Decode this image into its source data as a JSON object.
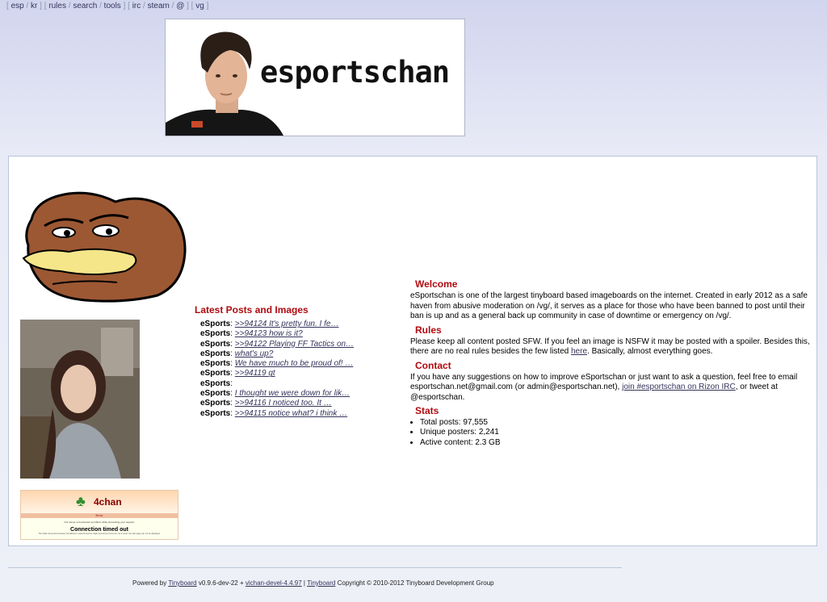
{
  "boardlist": {
    "groups": [
      [
        "esp",
        "kr"
      ],
      [
        "rules",
        "search",
        "tools"
      ],
      [
        "irc",
        "steam",
        "@"
      ],
      [
        "vg"
      ]
    ]
  },
  "banner": {
    "site_name": "esportschan"
  },
  "latest": {
    "title": "Latest Posts and Images",
    "items": [
      {
        "board": "eSports",
        "post": ">>94124 It's pretty fun. I fe…"
      },
      {
        "board": "eSports",
        "post": ">>94123 how is it?"
      },
      {
        "board": "eSports",
        "post": ">>94122 Playing FF Tactics on…"
      },
      {
        "board": "eSports",
        "post": "what's up?"
      },
      {
        "board": "eSports",
        "post": "We have much to be proud of! …"
      },
      {
        "board": "eSports",
        "post": ">>94119 gt"
      },
      {
        "board": "eSports",
        "post": ""
      },
      {
        "board": "eSports",
        "post": "I thought we were down for lik…"
      },
      {
        "board": "eSports",
        "post": ">>94116 I noticed too. It …"
      },
      {
        "board": "eSports",
        "post": ">>94115 notice what? i think …"
      }
    ]
  },
  "thumbs": {
    "error_card": {
      "brand": "4chan",
      "error": "Error",
      "message": "Our server encountered a problem while processing your request.",
      "heading": "Connection timed out",
      "detail": "The initial connection between CloudFlare's network and the origin web server timed out. As a result, the web page can not be displayed."
    }
  },
  "welcome": {
    "title": "Welcome",
    "text": "eSportschan is one of the largest tinyboard based imageboards on the internet. Created in early 2012 as a safe haven from abusive moderation on /vg/, it serves as a place for those who have been banned to post until their ban is up and as a general back up community in case of downtime or emergency on /vg/."
  },
  "rules": {
    "title": "Rules",
    "text_before": "Please keep all content posted SFW. If you feel an image is NSFW it may be posted with a spoiler. Besides this, there are no real rules besides the few listed ",
    "link": "here",
    "text_after": ". Basically, almost everything goes."
  },
  "contact": {
    "title": "Contact",
    "text_before": "If you have any suggestions on how to improve eSportschan or just want to ask a question, feel free to email esportschan.net@gmail.com (or admin@esportschan.net), ",
    "link": "join #esportschan on Rizon IRC",
    "text_after": ", or tweet at @esportschan."
  },
  "stats": {
    "title": "Stats",
    "items": [
      "Total posts: 97,555",
      "Unique posters: 2,241",
      "Active content: 2.3 GB"
    ]
  },
  "footer": {
    "powered": "Powered by ",
    "tinyboard": "Tinyboard",
    "version": " v0.9.6-dev-22 + ",
    "vichan": "vichan-devel-4.4.97",
    "sep": " | ",
    "tinyboard2": "Tinyboard",
    "copyright": " Copyright © 2010-2012 Tinyboard Development Group"
  }
}
